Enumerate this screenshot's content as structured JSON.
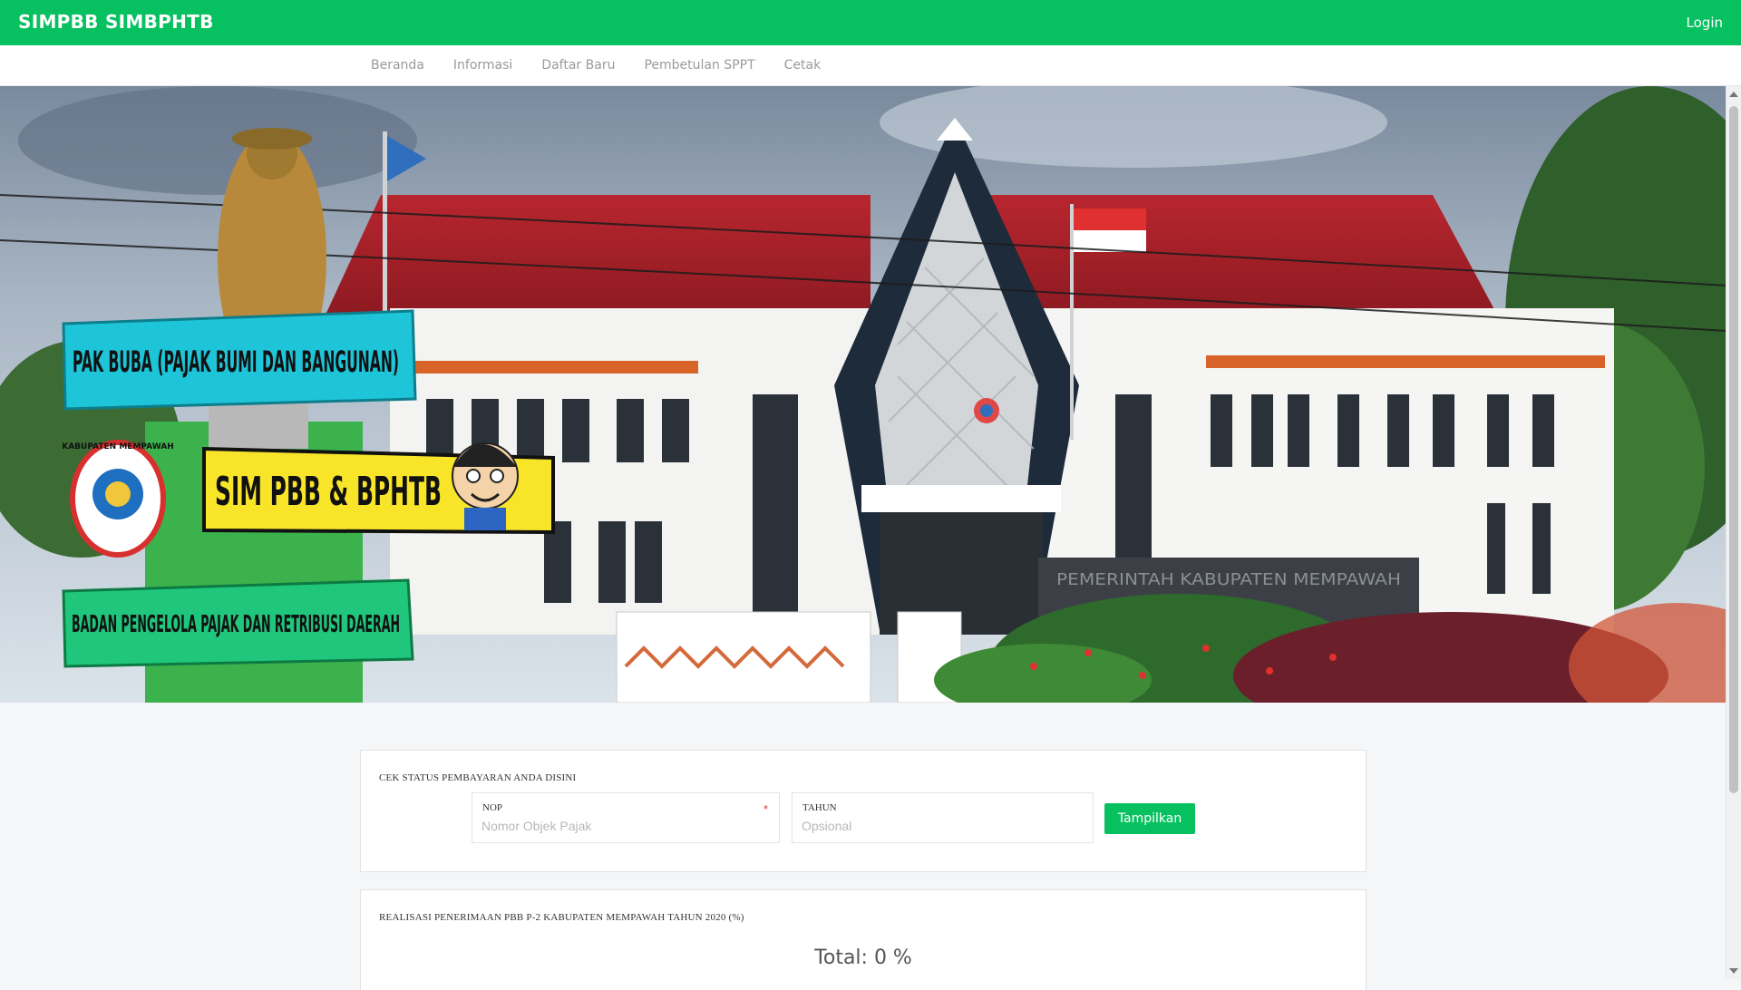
{
  "topbar": {
    "brand": "SIMPBB SIMBPHTB",
    "login": "Login",
    "color": "#07c160"
  },
  "nav": {
    "items": [
      "Beranda",
      "Informasi",
      "Daftar Baru",
      "Pembetulan SPPT",
      "Cetak"
    ]
  },
  "banner": {
    "sign_top": "PAK BUBA (PAJAK BUMI DAN BANGUNAN)",
    "sign_middle": "SIM PBB & BPHTB",
    "sign_bottom": "BADAN PENGELOLA PAJAK DAN RETRIBUSI DAERAH",
    "seal_text": "KABUPATEN MEMPAWAH",
    "building_plaque": "PEMERINTAH KABUPATEN MEMPAWAH"
  },
  "status_card": {
    "title": "CEK STATUS PEMBAYARAN ANDA DISINI",
    "nop_label": "NOP",
    "nop_required": "*",
    "nop_placeholder": "Nomor Objek Pajak",
    "tahun_label": "TAHUN",
    "tahun_placeholder": "Opsional",
    "button": "Tampilkan"
  },
  "realisasi_card": {
    "title": "REALISASI PENERIMAAN PBB P-2 KABUPATEN MEMPAWAH TAHUN 2020 (%)",
    "total": "Total: 0 %"
  }
}
